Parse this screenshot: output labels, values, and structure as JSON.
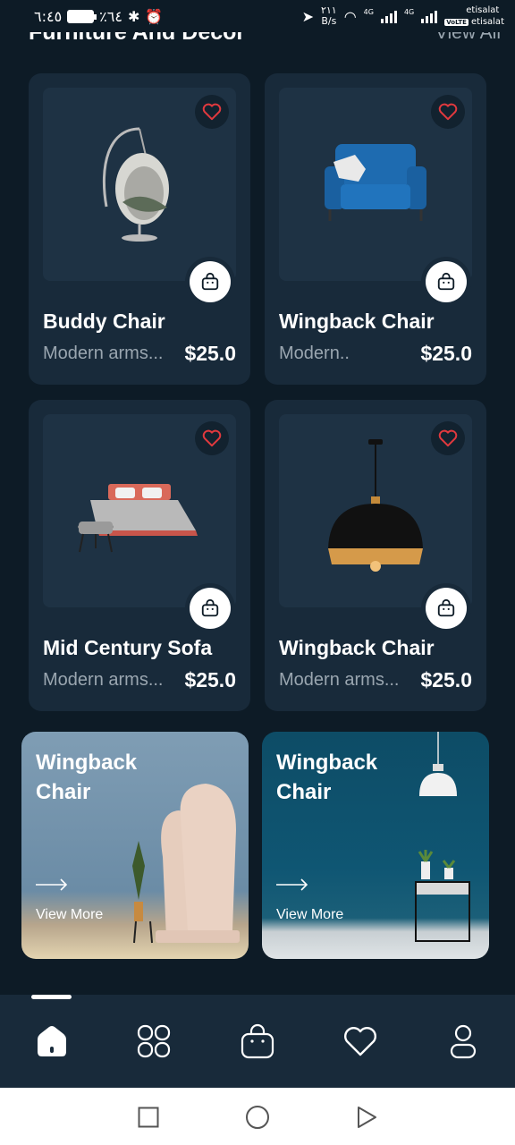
{
  "status_bar": {
    "time": "٦:٤٥",
    "battery": "٪٦٤",
    "speed_value": "٢١١",
    "speed_unit": "B/s",
    "network_1": "4G",
    "network_2": "4G",
    "volte": "VoLTE",
    "carrier_1": "etisalat",
    "carrier_2": "etisalat"
  },
  "header": {
    "title": "Furniture And Decor",
    "view_all": "View All"
  },
  "products": [
    {
      "name": "Buddy Chair",
      "description": "Modern arms...",
      "price": "$25.0",
      "image_icon": "hanging-egg-chair-icon"
    },
    {
      "name": "Wingback Chair",
      "description": "Modern..",
      "price": "$25.0",
      "image_icon": "blue-armchair-icon"
    },
    {
      "name": "Mid Century Sofa",
      "description": "Modern arms...",
      "price": "$25.0",
      "image_icon": "bed-with-stool-icon"
    },
    {
      "name": "Wingback Chair",
      "description": "Modern arms...",
      "price": "$25.0",
      "image_icon": "pendant-lamp-icon"
    }
  ],
  "promos": [
    {
      "title": "Wingback Chair",
      "link": "View More",
      "image_icon": "face-sculpture-icon"
    },
    {
      "title": "Wingback Chair",
      "link": "View More",
      "image_icon": "lamp-and-side-table-icon"
    }
  ],
  "bottom_nav": {
    "items": [
      "home-icon",
      "categories-icon",
      "bag-icon",
      "heart-icon",
      "profile-icon"
    ],
    "active": "home-icon"
  },
  "colors": {
    "background": "#0d1b26",
    "card": "#182a3a",
    "image_box": "#1e3244",
    "favorite_heart": "#e0393e",
    "muted_text": "#9aa6b0"
  }
}
